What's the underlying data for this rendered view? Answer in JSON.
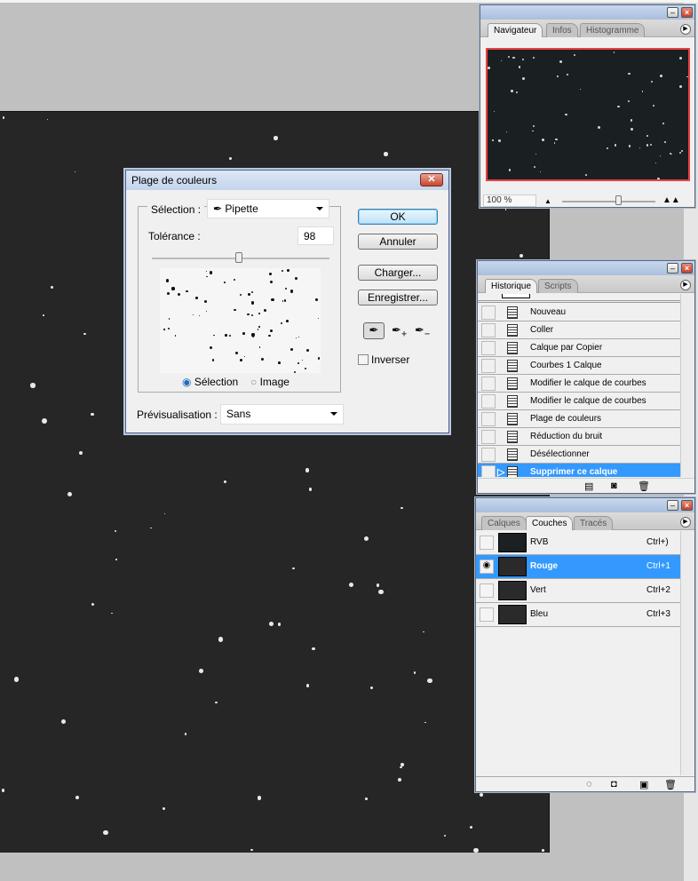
{
  "dialog": {
    "title": "Plage de couleurs",
    "selection_label": "Sélection :",
    "selection_value": "Pipette",
    "tolerance_label": "Tolérance :",
    "tolerance_value": "98",
    "tolerance_percent": 49,
    "radio_selection": "Sélection",
    "radio_image": "Image",
    "preview_label": "Prévisualisation :",
    "preview_value": "Sans",
    "ok": "OK",
    "cancel": "Annuler",
    "load": "Charger...",
    "save": "Enregistrer...",
    "invert": "Inverser",
    "close": "✕"
  },
  "navigator": {
    "tabs": [
      "Navigateur",
      "Infos",
      "Histogramme"
    ],
    "zoom": "100 %",
    "zoom_slider_percent": 60
  },
  "history": {
    "tabs": [
      "Historique",
      "Scripts"
    ],
    "items": [
      "Nouveau",
      "Coller",
      "Calque par Copier",
      "Courbes 1 Calque",
      "Modifier le calque de courbes",
      "Modifier le calque de courbes",
      "Plage de couleurs",
      "Réduction du bruit",
      "Désélectionner",
      "Supprimer ce calque"
    ],
    "selected_index": 9
  },
  "channels": {
    "tabs": [
      "Calques",
      "Couches",
      "Tracés"
    ],
    "items": [
      {
        "name": "RVB",
        "shortcut": "Ctrl+)"
      },
      {
        "name": "Rouge",
        "shortcut": "Ctrl+1"
      },
      {
        "name": "Vert",
        "shortcut": "Ctrl+2"
      },
      {
        "name": "Bleu",
        "shortcut": "Ctrl+3"
      }
    ],
    "selected_index": 1
  },
  "colors": {
    "selection": "#3399ff",
    "canvas": "#262626",
    "nav_frame": "#e84040"
  }
}
